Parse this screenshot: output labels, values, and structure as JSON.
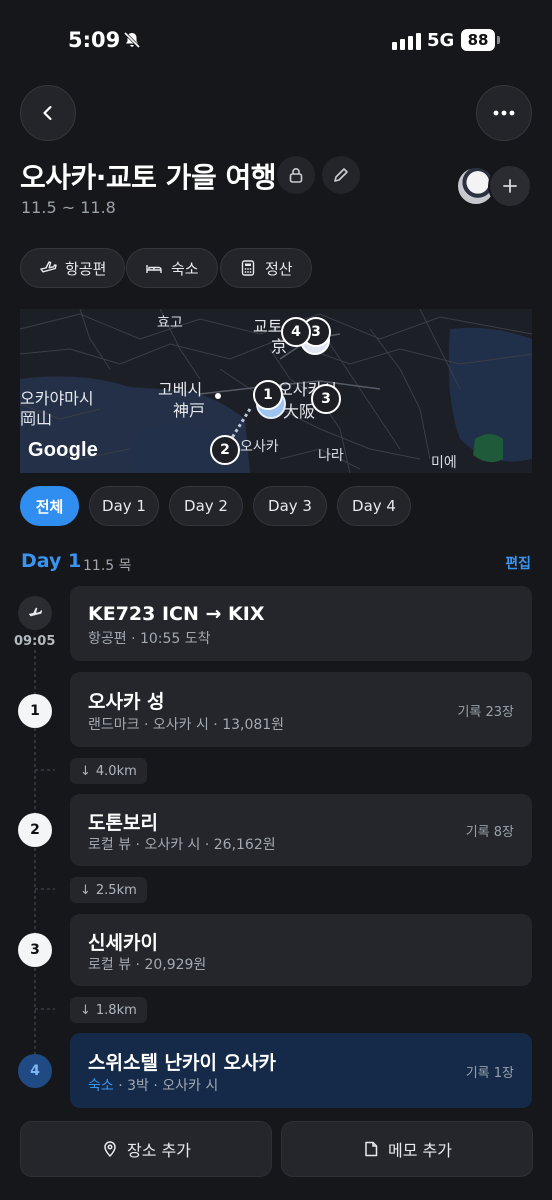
{
  "status_bar": {
    "time": "5:09",
    "network": "5G",
    "battery": "88"
  },
  "header": {
    "title": "오사카·교토 가을 여행",
    "dates": "11.5 ~ 11.8",
    "back_icon": "chevron-left-icon",
    "more_icon": "more-horizontal-icon"
  },
  "chips": [
    {
      "label": "항공편",
      "icon": "airplane-icon"
    },
    {
      "label": "숙소",
      "icon": "bed-icon"
    },
    {
      "label": "정산",
      "icon": "calculator-icon"
    }
  ],
  "map": {
    "labels": [
      "효고",
      "교토",
      "京",
      "오카야마시",
      "岡山",
      "고베시",
      "神戸",
      "오사카시",
      "大阪",
      "오사카",
      "나라",
      "미에"
    ],
    "pins": [
      "1",
      "2",
      "3",
      "4",
      "3"
    ],
    "attribution": "Google"
  },
  "day_tabs": [
    "전체",
    "Day 1",
    "Day 2",
    "Day 3",
    "Day 4"
  ],
  "day_section": {
    "title": "Day 1",
    "date": "11.5 목",
    "edit_label": "편집"
  },
  "flight": {
    "time": "09:05",
    "title": "KE723 ICN → KIX",
    "subtitle": "항공편 · 10:55 도착"
  },
  "places": [
    {
      "number": "1",
      "name": "오사카 성",
      "subtitle": "랜드마크 · 오사카 시 · 13,081원",
      "records": "기록 23장"
    },
    {
      "number": "2",
      "name": "도톤보리",
      "subtitle": "로컬 뷰 · 오사카 시 · 26,162원",
      "records": "기록 8장"
    },
    {
      "number": "3",
      "name": "신세카이",
      "subtitle": "로컬 뷰 · 20,929원",
      "records": ""
    },
    {
      "number": "4",
      "name": "스위소텔 난카이 오사카",
      "subtitle_accent": "숙소",
      "subtitle": " · 3박 · 오사카 시",
      "records": "기록 1장"
    }
  ],
  "distances": [
    "4.0km",
    "2.5km",
    "1.8km"
  ],
  "bottom": {
    "add_place": "장소 추가",
    "add_memo": "메모 추가"
  },
  "colors": {
    "accent": "#2f8ef0",
    "background": "#16171b",
    "card": "#24262b",
    "active_card": "#142a48"
  }
}
